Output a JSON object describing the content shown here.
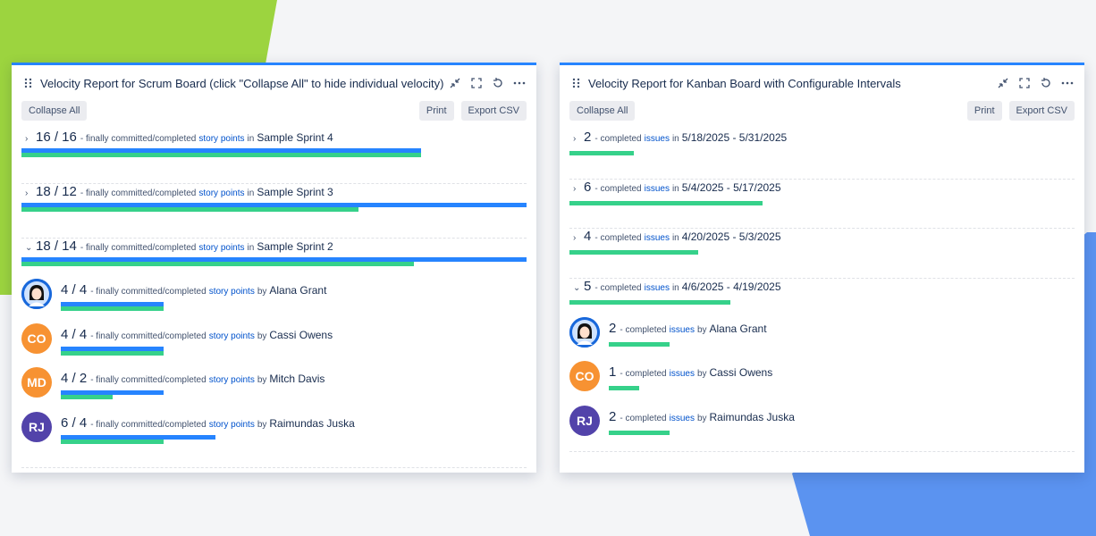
{
  "scrum": {
    "title": "Velocity Report for Scrum Board (click \"Collapse All\" to hide individual velocity)",
    "collapse_label": "Collapse All",
    "print_label": "Print",
    "export_label": "Export CSV",
    "sprints": [
      {
        "chevron": "›",
        "committed": 16,
        "completed": 16,
        "label": "16 / 16",
        "text": "- finally committed/completed",
        "link": "story points",
        "in": "in",
        "name": "Sample Sprint 4"
      },
      {
        "chevron": "›",
        "committed": 18,
        "completed": 12,
        "label": "18 / 12",
        "text": "- finally committed/completed",
        "link": "story points",
        "in": "in",
        "name": "Sample Sprint 3"
      },
      {
        "chevron": "⌄",
        "committed": 18,
        "completed": 14,
        "label": "18 / 14",
        "text": "- finally committed/completed",
        "link": "story points",
        "in": "in",
        "name": "Sample Sprint 2"
      }
    ],
    "users": [
      {
        "initials": "",
        "color": "#1868db",
        "committed": 4,
        "completed": 4,
        "label": "4 / 4",
        "text": "- finally committed/completed",
        "link": "story points",
        "by": "by",
        "name": "Alana Grant"
      },
      {
        "initials": "CO",
        "color": "#f79232",
        "committed": 4,
        "completed": 4,
        "label": "4 / 4",
        "text": "- finally committed/completed",
        "link": "story points",
        "by": "by",
        "name": "Cassi Owens"
      },
      {
        "initials": "MD",
        "color": "#f79232",
        "committed": 4,
        "completed": 2,
        "label": "4 / 2",
        "text": "- finally committed/completed",
        "link": "story points",
        "by": "by",
        "name": "Mitch Davis"
      },
      {
        "initials": "RJ",
        "color": "#5243aa",
        "committed": 6,
        "completed": 4,
        "label": "6 / 4",
        "text": "- finally committed/completed",
        "link": "story points",
        "by": "by",
        "name": "Raimundas Juska"
      }
    ]
  },
  "kanban": {
    "title": "Velocity Report for Kanban Board with Configurable Intervals",
    "collapse_label": "Collapse All",
    "print_label": "Print",
    "export_label": "Export CSV",
    "intervals": [
      {
        "chevron": "›",
        "completed": 2,
        "label": "2",
        "text": "- completed",
        "link": "issues",
        "in": "in",
        "name": "5/18/2025  - 5/31/2025"
      },
      {
        "chevron": "›",
        "completed": 6,
        "label": "6",
        "text": "- completed",
        "link": "issues",
        "in": "in",
        "name": "5/4/2025  - 5/17/2025"
      },
      {
        "chevron": "›",
        "completed": 4,
        "label": "4",
        "text": "- completed",
        "link": "issues",
        "in": "in",
        "name": "4/20/2025  - 5/3/2025"
      },
      {
        "chevron": "⌄",
        "completed": 5,
        "label": "5",
        "text": "- completed",
        "link": "issues",
        "in": "in",
        "name": "4/6/2025  - 4/19/2025"
      }
    ],
    "users": [
      {
        "initials": "",
        "color": "#1868db",
        "completed": 2,
        "label": "2",
        "text": "- completed",
        "link": "issues",
        "by": "by",
        "name": "Alana Grant"
      },
      {
        "initials": "CO",
        "color": "#f79232",
        "completed": 1,
        "label": "1",
        "text": "- completed",
        "link": "issues",
        "by": "by",
        "name": "Cassi Owens"
      },
      {
        "initials": "RJ",
        "color": "#5243aa",
        "completed": 2,
        "label": "2",
        "text": "- completed",
        "link": "issues",
        "by": "by",
        "name": "Raimundas Juska"
      }
    ]
  }
}
